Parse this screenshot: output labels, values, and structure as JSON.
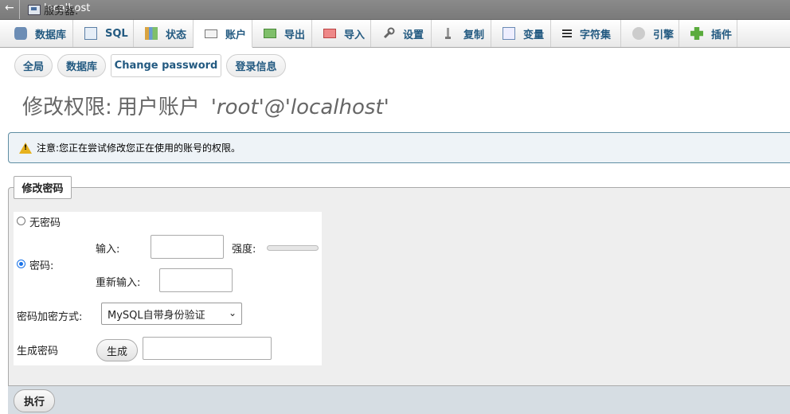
{
  "topbar": {
    "back": "←",
    "server_label": "服务器:",
    "server_name": "localhost"
  },
  "tabs": [
    {
      "label": "数据库",
      "icon": "database-icon"
    },
    {
      "label": "SQL",
      "icon": "sql-icon"
    },
    {
      "label": "状态",
      "icon": "status-icon"
    },
    {
      "label": "账户",
      "icon": "user-accounts-icon"
    },
    {
      "label": "导出",
      "icon": "export-icon"
    },
    {
      "label": "导入",
      "icon": "import-icon"
    },
    {
      "label": "设置",
      "icon": "wrench-icon"
    },
    {
      "label": "复制",
      "icon": "replication-icon"
    },
    {
      "label": "变量",
      "icon": "variables-icon"
    },
    {
      "label": "字符集",
      "icon": "charset-icon"
    },
    {
      "label": "引擎",
      "icon": "engine-icon"
    },
    {
      "label": "插件",
      "icon": "plugin-icon"
    }
  ],
  "active_tab": "账户",
  "subtabs": [
    "全局",
    "数据库",
    "Change password",
    "登录信息"
  ],
  "active_subtab": "Change password",
  "title": {
    "prefix": "修改权限:",
    "middle": "用户账户",
    "user": "'root'@'localhost'"
  },
  "notice": "注意:您正在尝试修改您正在使用的账号的权限。",
  "form": {
    "legend": "修改密码",
    "no_password": "无密码",
    "password": "密码:",
    "enter": "输入:",
    "strength": "强度:",
    "reenter": "重新输入:",
    "hashing_label": "密码加密方式:",
    "hashing_value": "MySQL自带身份验证",
    "generate_label": "生成密码",
    "generate_button": "生成",
    "submit": "执行"
  }
}
